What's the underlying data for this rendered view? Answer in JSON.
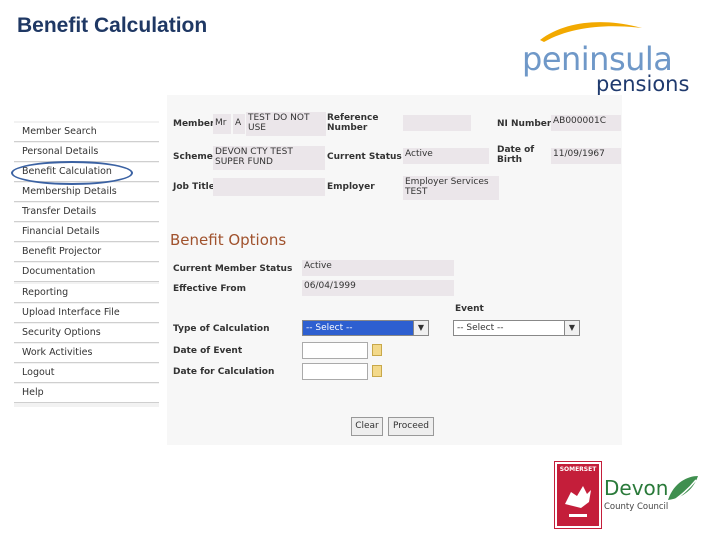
{
  "slide": {
    "title": "Benefit Calculation"
  },
  "logos": {
    "peninsula_word": "peninsula",
    "peninsula_sub": "pensions",
    "devon_word": "Devon",
    "devon_sub": "County Council",
    "somerset_word": "SOMERSET"
  },
  "sidebar": {
    "items": [
      {
        "label": "Member Search"
      },
      {
        "label": "Personal Details"
      },
      {
        "label": "Benefit Calculation"
      },
      {
        "label": "Membership Details"
      },
      {
        "label": "Transfer Details"
      },
      {
        "label": "Financial Details"
      },
      {
        "label": "Benefit Projector"
      },
      {
        "label": "Documentation"
      },
      {
        "label": "Reporting"
      },
      {
        "label": "Upload Interface File"
      },
      {
        "label": "Security Options"
      },
      {
        "label": "Work Activities"
      },
      {
        "label": "Logout"
      },
      {
        "label": "Help"
      }
    ]
  },
  "member": {
    "member_label": "Member",
    "title_value": "Mr",
    "initial_value": "A",
    "name_value": "TEST DO NOT USE",
    "reference_label": "Reference Number",
    "reference_value": "",
    "ni_label": "NI Number",
    "ni_value": "AB000001C",
    "scheme_label": "Scheme",
    "scheme_value": "DEVON CTY TEST SUPER FUND",
    "status_label": "Current Status",
    "status_value": "Active",
    "dob_label": "Date of Birth",
    "dob_value": "11/09/1967",
    "jobtitle_label": "Job Title",
    "jobtitle_value": "",
    "employer_label": "Employer",
    "employer_value": "Employer Services TEST"
  },
  "benefit_options": {
    "heading": "Benefit Options",
    "current_status_label": "Current Member Status",
    "current_status_value": "Active",
    "effective_from_label": "Effective From",
    "effective_from_value": "06/04/1999",
    "event_label": "Event",
    "type_label": "Type of Calculation",
    "type_select": "-- Select --",
    "event_select": "-- Select --",
    "date_event_label": "Date of Event",
    "date_calc_label": "Date for Calculation",
    "clear_button": "Clear",
    "proceed_button": "Proceed"
  }
}
